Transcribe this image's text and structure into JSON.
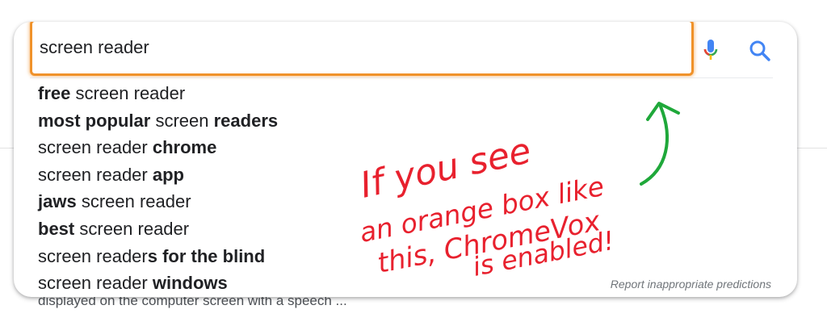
{
  "search": {
    "query": "screen reader"
  },
  "suggestions": [
    {
      "parts": [
        {
          "text": "free",
          "bold": true
        },
        {
          "text": " screen reader",
          "bold": false
        }
      ]
    },
    {
      "parts": [
        {
          "text": "most popular",
          "bold": true
        },
        {
          "text": " screen ",
          "bold": false
        },
        {
          "text": "readers",
          "bold": true
        }
      ]
    },
    {
      "parts": [
        {
          "text": "screen reader ",
          "bold": false
        },
        {
          "text": "chrome",
          "bold": true
        }
      ]
    },
    {
      "parts": [
        {
          "text": "screen reader ",
          "bold": false
        },
        {
          "text": "app",
          "bold": true
        }
      ]
    },
    {
      "parts": [
        {
          "text": "jaws",
          "bold": true
        },
        {
          "text": " screen reader",
          "bold": false
        }
      ]
    },
    {
      "parts": [
        {
          "text": "best",
          "bold": true
        },
        {
          "text": " screen reader",
          "bold": false
        }
      ]
    },
    {
      "parts": [
        {
          "text": "screen reader",
          "bold": false
        },
        {
          "text": "s for the blind",
          "bold": true
        }
      ]
    },
    {
      "parts": [
        {
          "text": "screen reader ",
          "bold": false
        },
        {
          "text": "windows",
          "bold": true
        }
      ]
    }
  ],
  "footer": {
    "report_link": "Report inappropriate predictions"
  },
  "background": {
    "snippet": "displayed on the computer screen with a speech ..."
  },
  "annotation": {
    "line1": "If you see",
    "line2": "an orange box like",
    "line3": "this, ChromeVox",
    "line4": "is enabled!",
    "text_color": "#e8212e",
    "arrow_color": "#1fa83a"
  },
  "icons": {
    "mic": "microphone-icon",
    "search": "magnifier-icon"
  },
  "colors": {
    "focus_ring": "#f0922a",
    "search_blue": "#4285f4",
    "text": "#202124",
    "muted": "#70757a"
  }
}
